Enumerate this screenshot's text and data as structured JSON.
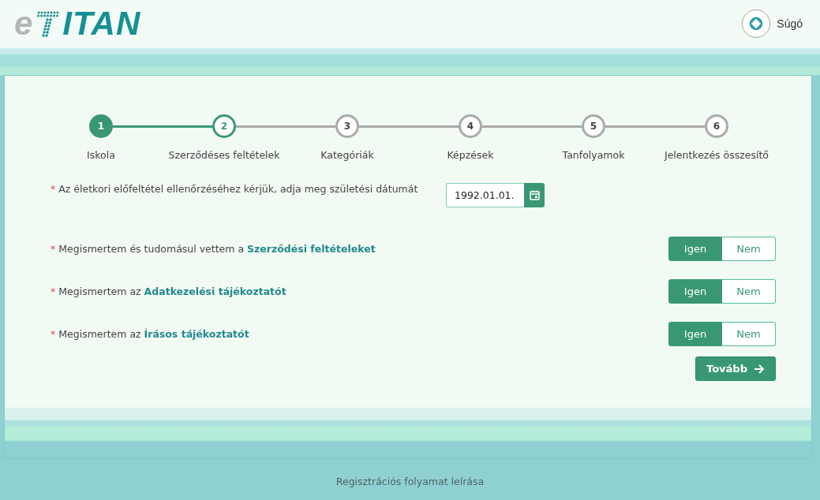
{
  "logo": {
    "prefix": "e",
    "name": "ITAN"
  },
  "help": {
    "label": "Súgó"
  },
  "steps": [
    {
      "number": "1",
      "label": "Iskola",
      "completed": true,
      "selected": false
    },
    {
      "number": "2",
      "label": "Szerződéses feltételek",
      "completed": false,
      "selected": true
    },
    {
      "number": "3",
      "label": "Kategóriák",
      "completed": false,
      "selected": false
    },
    {
      "number": "4",
      "label": "Képzések",
      "completed": false,
      "selected": false
    },
    {
      "number": "5",
      "label": "Tanfolyamok",
      "completed": false,
      "selected": false
    },
    {
      "number": "6",
      "label": "Jelentkezés összesítő",
      "completed": false,
      "selected": false
    }
  ],
  "birth_date": {
    "required_mark": "*",
    "label": "Az életkori előfeltétel ellenőrzéséhez kérjük, adja meg születési dátumát",
    "value": "1992.01.01."
  },
  "questions": [
    {
      "required_mark": "*",
      "text": "Megismertem és tudomásul vettem a ",
      "link": "Szerződési feltételeket",
      "options": [
        {
          "label": "Igen",
          "selected": true
        },
        {
          "label": "Nem",
          "selected": false
        }
      ]
    },
    {
      "required_mark": "*",
      "text": "Megismertem az ",
      "link": "Adatkezelési tájékoztatót",
      "options": [
        {
          "label": "Igen",
          "selected": true
        },
        {
          "label": "Nem",
          "selected": false
        }
      ]
    },
    {
      "required_mark": "*",
      "text": "Megismertem az ",
      "link": "Írásos tájékoztatót",
      "options": [
        {
          "label": "Igen",
          "selected": true
        },
        {
          "label": "Nem",
          "selected": false
        }
      ]
    }
  ],
  "next_button": {
    "label": "Tovább"
  },
  "footer": {
    "link": "Regisztrációs folyamat leírása"
  }
}
